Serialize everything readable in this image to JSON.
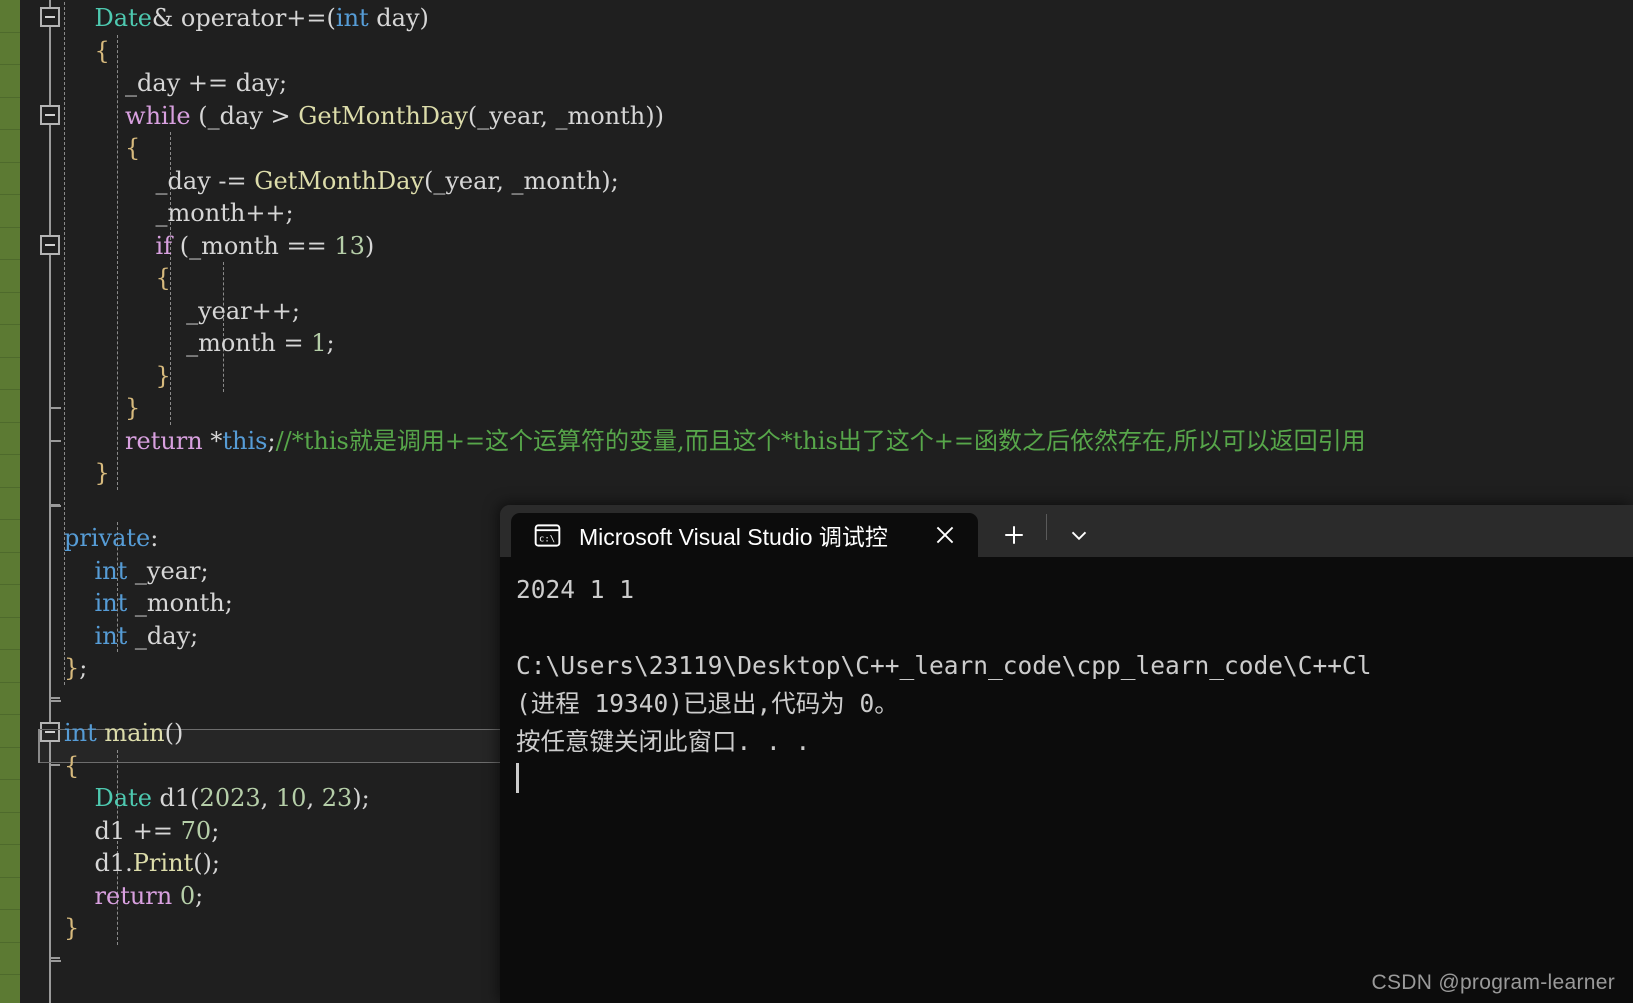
{
  "editor": {
    "language": "cpp",
    "colors": {
      "background": "#1f1f1f",
      "keyword": "#d8a0df",
      "type": "#4ec9b0",
      "builtin_type": "#569cd6",
      "function": "#dcdcaa",
      "number": "#b5cea8",
      "comment": "#57a64a",
      "identifier": "#d6d6d6",
      "change_bar": "#5c7a33"
    },
    "lines": [
      {
        "id": "l1",
        "indent": 1,
        "fold": true,
        "tokens": [
          {
            "t": "Date",
            "c": "ty"
          },
          {
            "t": "& ",
            "c": "op"
          },
          {
            "t": "operator",
            "c": "id"
          },
          {
            "t": "+=(",
            "c": "op"
          },
          {
            "t": "int",
            "c": "kw"
          },
          {
            "t": " day)",
            "c": "id"
          }
        ]
      },
      {
        "id": "l2",
        "indent": 1,
        "fold": false,
        "tokens": [
          {
            "t": "{",
            "c": "br1"
          }
        ]
      },
      {
        "id": "l3",
        "indent": 2,
        "fold": false,
        "tokens": [
          {
            "t": "_day ",
            "c": "id"
          },
          {
            "t": "+=",
            "c": "op"
          },
          {
            "t": " day;",
            "c": "id"
          }
        ]
      },
      {
        "id": "l4",
        "indent": 2,
        "fold": true,
        "tokens": [
          {
            "t": "while",
            "c": "k"
          },
          {
            "t": " (_day ",
            "c": "id"
          },
          {
            "t": ">",
            "c": "op"
          },
          {
            "t": " ",
            "c": "id"
          },
          {
            "t": "GetMonthDay",
            "c": "fn"
          },
          {
            "t": "(_year, _month))",
            "c": "id"
          }
        ]
      },
      {
        "id": "l5",
        "indent": 2,
        "fold": false,
        "tokens": [
          {
            "t": "{",
            "c": "br1"
          }
        ]
      },
      {
        "id": "l6",
        "indent": 3,
        "fold": false,
        "tokens": [
          {
            "t": "_day ",
            "c": "id"
          },
          {
            "t": "-=",
            "c": "op"
          },
          {
            "t": " ",
            "c": "id"
          },
          {
            "t": "GetMonthDay",
            "c": "fn"
          },
          {
            "t": "(_year, _month);",
            "c": "id"
          }
        ]
      },
      {
        "id": "l7",
        "indent": 3,
        "fold": false,
        "tokens": [
          {
            "t": "_month++;",
            "c": "id"
          }
        ]
      },
      {
        "id": "l8",
        "indent": 3,
        "fold": true,
        "tokens": [
          {
            "t": "if",
            "c": "k"
          },
          {
            "t": " (_month ",
            "c": "id"
          },
          {
            "t": "==",
            "c": "op"
          },
          {
            "t": " ",
            "c": "id"
          },
          {
            "t": "13",
            "c": "num"
          },
          {
            "t": ")",
            "c": "id"
          }
        ]
      },
      {
        "id": "l9",
        "indent": 3,
        "fold": false,
        "tokens": [
          {
            "t": "{",
            "c": "br1"
          }
        ]
      },
      {
        "id": "l10",
        "indent": 4,
        "fold": false,
        "tokens": [
          {
            "t": "_year++;",
            "c": "id"
          }
        ]
      },
      {
        "id": "l11",
        "indent": 4,
        "fold": false,
        "tokens": [
          {
            "t": "_month = ",
            "c": "id"
          },
          {
            "t": "1",
            "c": "num"
          },
          {
            "t": ";",
            "c": "id"
          }
        ]
      },
      {
        "id": "l12",
        "indent": 3,
        "fold": false,
        "tokens": [
          {
            "t": "}",
            "c": "br1"
          }
        ]
      },
      {
        "id": "l13",
        "indent": 2,
        "fold": false,
        "tokens": [
          {
            "t": "}",
            "c": "br1"
          }
        ]
      },
      {
        "id": "l14",
        "indent": 2,
        "fold": false,
        "tokens": [
          {
            "t": "return",
            "c": "k"
          },
          {
            "t": " *",
            "c": "op"
          },
          {
            "t": "this",
            "c": "kw"
          },
          {
            "t": ";",
            "c": "id"
          },
          {
            "t": "//*this就是调用+=这个运算符的变量,而且这个*this出了这个+=函数之后依然存在,所以可以返回引用",
            "c": "cm"
          }
        ]
      },
      {
        "id": "l15",
        "indent": 1,
        "fold": false,
        "tokens": [
          {
            "t": "}",
            "c": "br1"
          }
        ]
      },
      {
        "id": "l16",
        "indent": 0,
        "fold": false,
        "tokens": [
          {
            "t": "",
            "c": "id"
          }
        ]
      },
      {
        "id": "l17",
        "indent": 0,
        "fold": false,
        "tokens": [
          {
            "t": "private",
            "c": "kw"
          },
          {
            "t": ":",
            "c": "id"
          }
        ]
      },
      {
        "id": "l18",
        "indent": 1,
        "fold": false,
        "tokens": [
          {
            "t": "int",
            "c": "kw"
          },
          {
            "t": " _year;",
            "c": "id"
          }
        ]
      },
      {
        "id": "l19",
        "indent": 1,
        "fold": false,
        "tokens": [
          {
            "t": "int",
            "c": "kw"
          },
          {
            "t": " _month;",
            "c": "id"
          }
        ]
      },
      {
        "id": "l20",
        "indent": 1,
        "fold": false,
        "tokens": [
          {
            "t": "int",
            "c": "kw"
          },
          {
            "t": " _day;",
            "c": "id"
          }
        ]
      },
      {
        "id": "l21",
        "indent": 0,
        "fold": false,
        "tokens": [
          {
            "t": "}",
            "c": "br1"
          },
          {
            "t": ";",
            "c": "id"
          }
        ]
      },
      {
        "id": "l22",
        "indent": 0,
        "fold": false,
        "tokens": [
          {
            "t": "",
            "c": "id"
          }
        ]
      },
      {
        "id": "l23",
        "indent": 0,
        "fold": true,
        "tokens": [
          {
            "t": "int",
            "c": "kw"
          },
          {
            "t": " ",
            "c": "id"
          },
          {
            "t": "main",
            "c": "fn"
          },
          {
            "t": "()",
            "c": "id"
          }
        ]
      },
      {
        "id": "l24",
        "indent": 0,
        "fold": false,
        "tokens": [
          {
            "t": "{",
            "c": "br1"
          }
        ]
      },
      {
        "id": "l25",
        "indent": 1,
        "fold": false,
        "tokens": [
          {
            "t": "Date",
            "c": "ty"
          },
          {
            "t": " d1(",
            "c": "id"
          },
          {
            "t": "2023",
            "c": "num"
          },
          {
            "t": ", ",
            "c": "id"
          },
          {
            "t": "10",
            "c": "num"
          },
          {
            "t": ", ",
            "c": "id"
          },
          {
            "t": "23",
            "c": "num"
          },
          {
            "t": ");",
            "c": "id"
          }
        ]
      },
      {
        "id": "l26",
        "indent": 1,
        "fold": false,
        "tokens": [
          {
            "t": "d1 ",
            "c": "id"
          },
          {
            "t": "+=",
            "c": "op"
          },
          {
            "t": " ",
            "c": "id"
          },
          {
            "t": "70",
            "c": "num"
          },
          {
            "t": ";",
            "c": "id"
          }
        ]
      },
      {
        "id": "l27",
        "indent": 1,
        "fold": false,
        "tokens": [
          {
            "t": "d1.",
            "c": "id"
          },
          {
            "t": "Print",
            "c": "fn"
          },
          {
            "t": "();",
            "c": "id"
          }
        ]
      },
      {
        "id": "l28",
        "indent": 1,
        "fold": false,
        "tokens": [
          {
            "t": "return",
            "c": "k"
          },
          {
            "t": " ",
            "c": "id"
          },
          {
            "t": "0",
            "c": "num"
          },
          {
            "t": ";",
            "c": "id"
          }
        ]
      },
      {
        "id": "l29",
        "indent": 0,
        "fold": false,
        "tokens": [
          {
            "t": "}",
            "c": "br1"
          }
        ]
      }
    ]
  },
  "console_window": {
    "tab": {
      "icon": "console-cmd-icon",
      "title": "Microsoft Visual Studio 调试控",
      "close_label": "✕"
    },
    "toolbar": {
      "new_tab_label": "+",
      "dropdown_label": "∨"
    },
    "output_lines": [
      "2024 1 1",
      "",
      "C:\\Users\\23119\\Desktop\\C++_learn_code\\cpp_learn_code\\C++Cl",
      "(进程 19340)已退出,代码为 0。",
      "按任意键关闭此窗口. . ."
    ],
    "colors": {
      "titlebar": "#2b2b2b",
      "body": "#0c0c0c",
      "text": "#cccccc"
    }
  },
  "watermark": {
    "text": "CSDN @program-learner"
  }
}
